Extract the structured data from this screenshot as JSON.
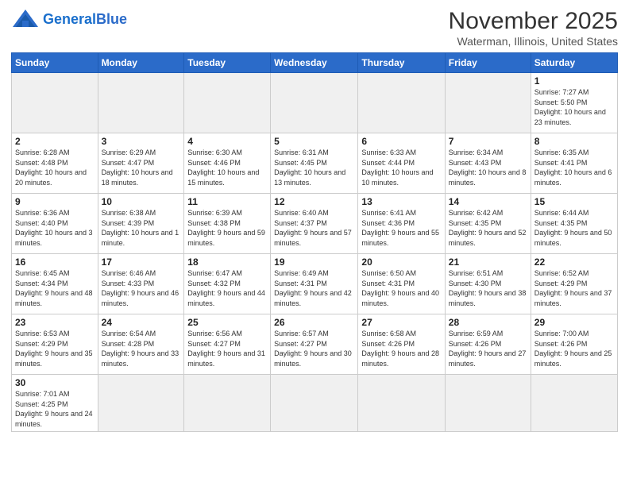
{
  "logo": {
    "text_general": "General",
    "text_blue": "Blue"
  },
  "header": {
    "month": "November 2025",
    "location": "Waterman, Illinois, United States"
  },
  "weekdays": [
    "Sunday",
    "Monday",
    "Tuesday",
    "Wednesday",
    "Thursday",
    "Friday",
    "Saturday"
  ],
  "weeks": [
    [
      {
        "day": "",
        "empty": true
      },
      {
        "day": "",
        "empty": true
      },
      {
        "day": "",
        "empty": true
      },
      {
        "day": "",
        "empty": true
      },
      {
        "day": "",
        "empty": true
      },
      {
        "day": "",
        "empty": true
      },
      {
        "day": "1",
        "info": "Sunrise: 7:27 AM\nSunset: 5:50 PM\nDaylight: 10 hours\nand 23 minutes."
      }
    ],
    [
      {
        "day": "2",
        "info": "Sunrise: 6:28 AM\nSunset: 4:48 PM\nDaylight: 10 hours\nand 20 minutes."
      },
      {
        "day": "3",
        "info": "Sunrise: 6:29 AM\nSunset: 4:47 PM\nDaylight: 10 hours\nand 18 minutes."
      },
      {
        "day": "4",
        "info": "Sunrise: 6:30 AM\nSunset: 4:46 PM\nDaylight: 10 hours\nand 15 minutes."
      },
      {
        "day": "5",
        "info": "Sunrise: 6:31 AM\nSunset: 4:45 PM\nDaylight: 10 hours\nand 13 minutes."
      },
      {
        "day": "6",
        "info": "Sunrise: 6:33 AM\nSunset: 4:44 PM\nDaylight: 10 hours\nand 10 minutes."
      },
      {
        "day": "7",
        "info": "Sunrise: 6:34 AM\nSunset: 4:43 PM\nDaylight: 10 hours\nand 8 minutes."
      },
      {
        "day": "8",
        "info": "Sunrise: 6:35 AM\nSunset: 4:41 PM\nDaylight: 10 hours\nand 6 minutes."
      }
    ],
    [
      {
        "day": "9",
        "info": "Sunrise: 6:36 AM\nSunset: 4:40 PM\nDaylight: 10 hours\nand 3 minutes."
      },
      {
        "day": "10",
        "info": "Sunrise: 6:38 AM\nSunset: 4:39 PM\nDaylight: 10 hours\nand 1 minute."
      },
      {
        "day": "11",
        "info": "Sunrise: 6:39 AM\nSunset: 4:38 PM\nDaylight: 9 hours\nand 59 minutes."
      },
      {
        "day": "12",
        "info": "Sunrise: 6:40 AM\nSunset: 4:37 PM\nDaylight: 9 hours\nand 57 minutes."
      },
      {
        "day": "13",
        "info": "Sunrise: 6:41 AM\nSunset: 4:36 PM\nDaylight: 9 hours\nand 55 minutes."
      },
      {
        "day": "14",
        "info": "Sunrise: 6:42 AM\nSunset: 4:35 PM\nDaylight: 9 hours\nand 52 minutes."
      },
      {
        "day": "15",
        "info": "Sunrise: 6:44 AM\nSunset: 4:35 PM\nDaylight: 9 hours\nand 50 minutes."
      }
    ],
    [
      {
        "day": "16",
        "info": "Sunrise: 6:45 AM\nSunset: 4:34 PM\nDaylight: 9 hours\nand 48 minutes."
      },
      {
        "day": "17",
        "info": "Sunrise: 6:46 AM\nSunset: 4:33 PM\nDaylight: 9 hours\nand 46 minutes."
      },
      {
        "day": "18",
        "info": "Sunrise: 6:47 AM\nSunset: 4:32 PM\nDaylight: 9 hours\nand 44 minutes."
      },
      {
        "day": "19",
        "info": "Sunrise: 6:49 AM\nSunset: 4:31 PM\nDaylight: 9 hours\nand 42 minutes."
      },
      {
        "day": "20",
        "info": "Sunrise: 6:50 AM\nSunset: 4:31 PM\nDaylight: 9 hours\nand 40 minutes."
      },
      {
        "day": "21",
        "info": "Sunrise: 6:51 AM\nSunset: 4:30 PM\nDaylight: 9 hours\nand 38 minutes."
      },
      {
        "day": "22",
        "info": "Sunrise: 6:52 AM\nSunset: 4:29 PM\nDaylight: 9 hours\nand 37 minutes."
      }
    ],
    [
      {
        "day": "23",
        "info": "Sunrise: 6:53 AM\nSunset: 4:29 PM\nDaylight: 9 hours\nand 35 minutes."
      },
      {
        "day": "24",
        "info": "Sunrise: 6:54 AM\nSunset: 4:28 PM\nDaylight: 9 hours\nand 33 minutes."
      },
      {
        "day": "25",
        "info": "Sunrise: 6:56 AM\nSunset: 4:27 PM\nDaylight: 9 hours\nand 31 minutes."
      },
      {
        "day": "26",
        "info": "Sunrise: 6:57 AM\nSunset: 4:27 PM\nDaylight: 9 hours\nand 30 minutes."
      },
      {
        "day": "27",
        "info": "Sunrise: 6:58 AM\nSunset: 4:26 PM\nDaylight: 9 hours\nand 28 minutes."
      },
      {
        "day": "28",
        "info": "Sunrise: 6:59 AM\nSunset: 4:26 PM\nDaylight: 9 hours\nand 27 minutes."
      },
      {
        "day": "29",
        "info": "Sunrise: 7:00 AM\nSunset: 4:26 PM\nDaylight: 9 hours\nand 25 minutes."
      }
    ],
    [
      {
        "day": "30",
        "info": "Sunrise: 7:01 AM\nSunset: 4:25 PM\nDaylight: 9 hours\nand 24 minutes."
      },
      {
        "day": "",
        "empty": true
      },
      {
        "day": "",
        "empty": true
      },
      {
        "day": "",
        "empty": true
      },
      {
        "day": "",
        "empty": true
      },
      {
        "day": "",
        "empty": true
      },
      {
        "day": "",
        "empty": true
      }
    ]
  ]
}
